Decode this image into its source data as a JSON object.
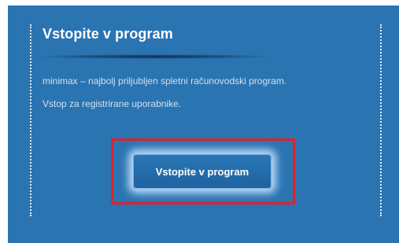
{
  "card": {
    "title": "Vstopite v program",
    "description": "minimax – najbolj priljubljen spletni računovodski program.",
    "subtext": "Vstop za registrirane uporabnike.",
    "enter_button_label": "Vstopite v program"
  },
  "colors": {
    "panel_background": "#2b74b2",
    "highlight_border": "#e0202a",
    "button_background": "#1f62a0"
  }
}
